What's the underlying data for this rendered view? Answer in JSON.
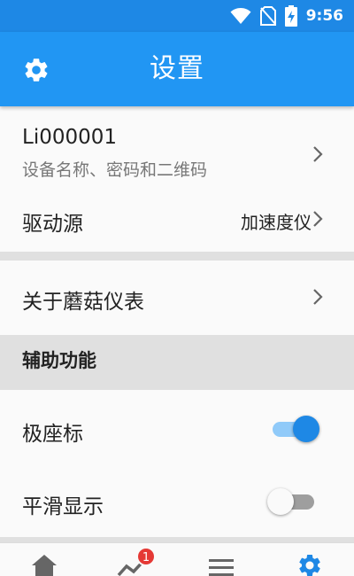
{
  "status_bar": {
    "time": "9:56",
    "icons": [
      "wifi-icon",
      "no-sim-icon",
      "battery-charging-icon"
    ]
  },
  "app_bar": {
    "title": "设置",
    "icon": "gear-icon"
  },
  "device": {
    "name": "Li000001",
    "subtitle": "设备名称、密码和二维码"
  },
  "drive_source": {
    "label": "驱动源",
    "value": "加速度仪"
  },
  "about": {
    "label": "关于蘑菇仪表"
  },
  "accessibility": {
    "header": "辅助功能",
    "polar": {
      "label": "极座标",
      "on": true
    },
    "smooth": {
      "label": "平滑显示",
      "on": false
    }
  },
  "bottom_nav": {
    "items": [
      {
        "icon": "home-icon"
      },
      {
        "icon": "chart-icon",
        "badge": "1"
      },
      {
        "icon": "list-icon"
      },
      {
        "icon": "gear-icon",
        "active": true
      }
    ]
  },
  "colors": {
    "primary": "#2196f3",
    "status_bar": "#1e88e5",
    "accent": "#1e88e5",
    "badge": "#e53935"
  }
}
